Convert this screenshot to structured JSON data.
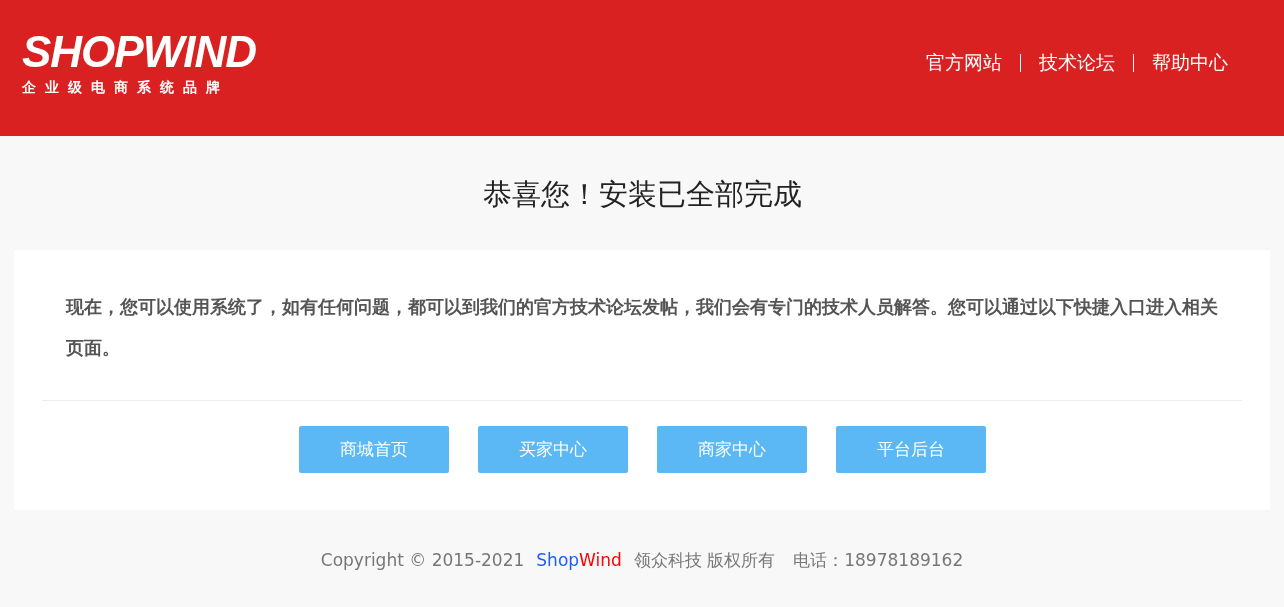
{
  "logo": {
    "wordmark": "SHOPWIND",
    "tagline": "企业级电商系统品牌"
  },
  "nav": [
    {
      "label": "官方网站"
    },
    {
      "label": "技术论坛"
    },
    {
      "label": "帮助中心"
    }
  ],
  "title": "恭喜您！安装已全部完成",
  "message": "现在，您可以使用系统了，如有任何问题，都可以到我们的官方技术论坛发帖，我们会有专门的技术人员解答。您可以通过以下快捷入口进入相关页面。",
  "buttons": [
    {
      "label": "商城首页"
    },
    {
      "label": "买家中心"
    },
    {
      "label": "商家中心"
    },
    {
      "label": "平台后台"
    }
  ],
  "footer": {
    "copyright": "Copyright © 2015-2021",
    "brand_first": "Shop",
    "brand_second": "Wind",
    "company": "领众科技 版权所有",
    "phone": "电话：18978189162"
  }
}
